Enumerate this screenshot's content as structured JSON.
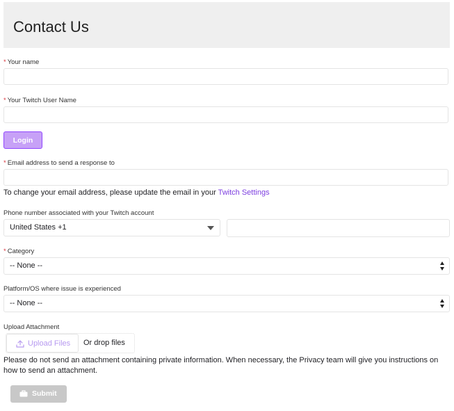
{
  "header": {
    "title": "Contact Us"
  },
  "required_marker": "*",
  "fields": {
    "name": {
      "label": "Your name",
      "value": "",
      "placeholder": ""
    },
    "twitch_username": {
      "label": "Your Twitch User Name",
      "value": "",
      "placeholder": ""
    },
    "email": {
      "label": "Email address to send a response to",
      "value": "",
      "placeholder": ""
    }
  },
  "login_button": {
    "label": "Login"
  },
  "email_note": {
    "text": "To change your email address, please update the email in your ",
    "link_text": "Twitch Settings"
  },
  "phone": {
    "label": "Phone number associated with your Twitch account",
    "country_selected": "United States +1",
    "number_value": "",
    "number_placeholder": ""
  },
  "category": {
    "label": "Category",
    "selected": "-- None --"
  },
  "platform": {
    "label": "Platform/OS where issue is experienced",
    "selected": "-- None --"
  },
  "attachment": {
    "label": "Upload Attachment",
    "upload_button": "Upload Files",
    "drop_text": "Or drop files",
    "warning": "Please do not send an attachment containing private information. When necessary, the Privacy team will give you instructions on how to send an attachment."
  },
  "submit_button": {
    "label": "Submit"
  },
  "icons": {
    "upload": "upload-icon",
    "submit": "briefcase-icon"
  },
  "colors": {
    "accent": "#9147ff",
    "link": "#7d3fe0",
    "login_button_bg": "#c7a1f7",
    "required": "#d9363e",
    "submit_disabled": "#c8c8c8",
    "header_bg": "#efefef"
  }
}
